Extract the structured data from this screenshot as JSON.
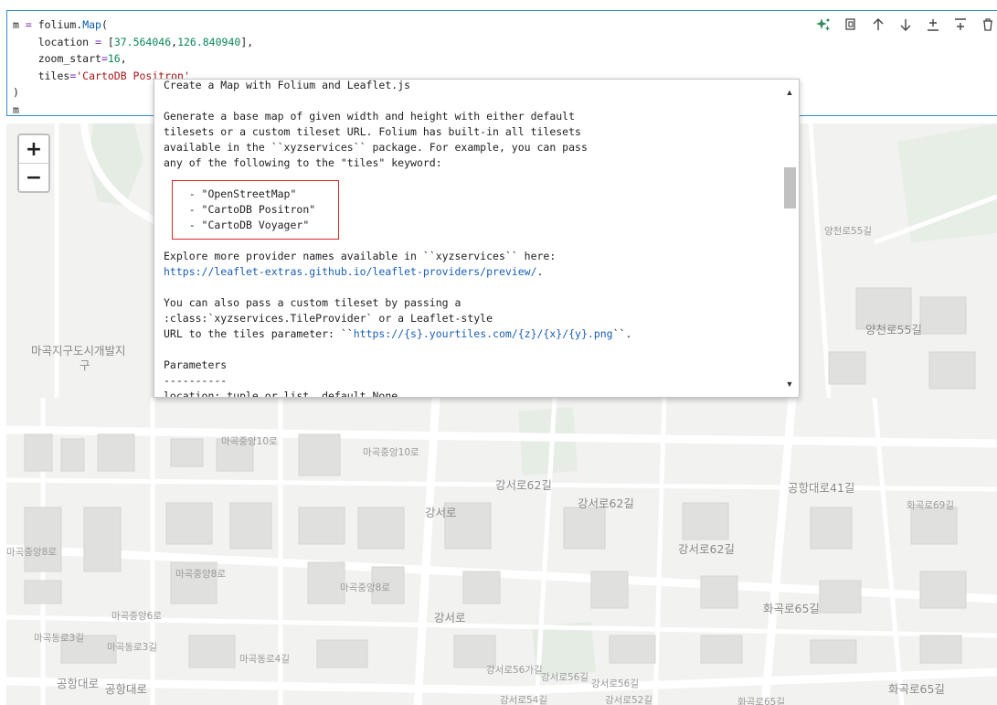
{
  "cell": {
    "code_lines": [
      "m = folium.Map(",
      "    location = [37.564046,126.840940],",
      "    zoom_start=16,",
      "    tiles='CartoDB Positron'",
      ")",
      "m"
    ]
  },
  "toolbar": {
    "icons": [
      "sparkle-icon",
      "copy-icon",
      "arrow-up-icon",
      "arrow-down-icon",
      "insert-above-icon",
      "insert-below-icon",
      "delete-icon"
    ]
  },
  "map": {
    "zoom_in": "+",
    "zoom_out": "−",
    "labels": [
      "마곡지구도시개발지",
      "구",
      "마곡중앙10로",
      "마곡중앙10로",
      "마곡중앙8로",
      "마곡중앙8로",
      "마곡중앙8로",
      "마곡중앙6로",
      "마곡동로3길",
      "마곡동로3길",
      "마곡동로4길",
      "공항대로",
      "공항대로",
      "강서로",
      "강서로",
      "강서로62길",
      "강서로62길",
      "강서로56길",
      "강서로56길",
      "강서로56가길",
      "강서로54길",
      "강서로52길",
      "강서로62길",
      "공항대로41길",
      "화곡로65길",
      "화곡로65길",
      "양천로55길",
      "양천로55길",
      "화곡로69길",
      "화곡로65길"
    ]
  },
  "popup": {
    "title_line": "Create a Map with Folium and Leaflet.js",
    "para1": [
      "Generate a base map of given width and height with either default",
      "tilesets or a custom tileset URL. Folium has built-in all tilesets",
      "available in the ``xyzservices`` package. For example, you can pass",
      "any of the following to the \"tiles\" keyword:"
    ],
    "tiles_list": [
      "    - \"OpenStreetMap\"",
      "    - \"CartoDB Positron\"",
      "    - \"CartoDB Voyager\""
    ],
    "explore_line": "Explore more provider names available in ``xyzservices`` here:",
    "explore_link": "https://leaflet-extras.github.io/leaflet-providers/preview/",
    "explore_end": ".",
    "para3": [
      "You can also pass a custom tileset by passing a",
      ":class:`xyzservices.TileProvider` or a Leaflet-style"
    ],
    "url_prefix": "URL to the tiles parameter: ``",
    "url_link": "https://{s}.yourtiles.com/{z}/{x}/{y}.png",
    "url_suffix": "``.",
    "params_title": "Parameters",
    "params_rule": "----------",
    "cut_line": "location: tuple or list, default None"
  }
}
